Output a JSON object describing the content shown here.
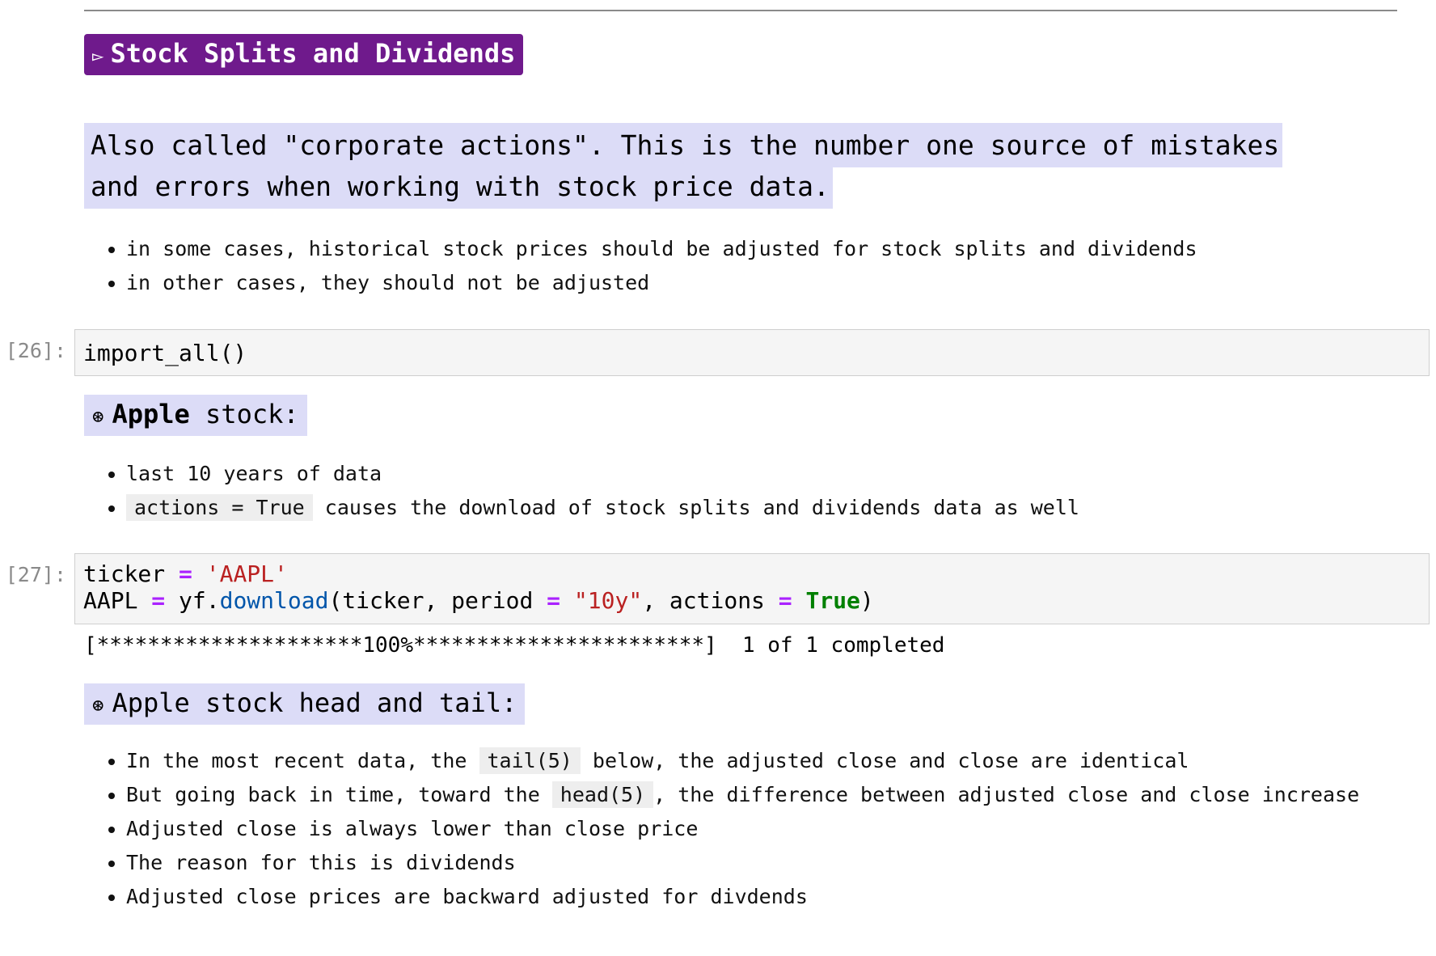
{
  "section": {
    "glyph": "▻",
    "title": "Stock Splits and Dividends"
  },
  "intro": {
    "text": "Also called \"corporate actions\". This is the number one source of mistakes and errors when working with stock price data."
  },
  "intro_bullets": [
    "in some cases, historical stock prices should be adjusted for stock splits and dividends",
    "in other cases, they should not be adjusted"
  ],
  "cell_26": {
    "prompt": "[26]:",
    "code": "import_all()"
  },
  "apple_header": {
    "glyph": "⊛",
    "bold": "Apple",
    "rest": " stock:"
  },
  "apple_bullets": {
    "item1": "last 10 years of data",
    "item2_code": "actions = True",
    "item2_text": " causes the download of stock splits and dividends data as well"
  },
  "cell_27": {
    "prompt": "[27]:",
    "line1": {
      "var": "ticker ",
      "op": "=",
      "sp": " ",
      "str": "'AAPL'"
    },
    "line2": {
      "var": "AAPL ",
      "op1": "=",
      "obj": " yf.",
      "fn": "download",
      "args1": "(ticker, period ",
      "op2": "=",
      "sp2": " ",
      "str": "\"10y\"",
      "args2": ", actions ",
      "op3": "=",
      "sp3": " ",
      "kw": "True",
      "close": ")"
    },
    "output": "[*********************100%***********************]  1 of 1 completed"
  },
  "head_tail_header": {
    "glyph": "⊛",
    "text": "Apple stock head and tail:"
  },
  "head_tail_bullets": {
    "b1_pre": "In the most recent data, the ",
    "b1_code": "tail(5)",
    "b1_post": " below, the adjusted close and close are identical",
    "b2_pre": "But going back in time, toward the ",
    "b2_code": "head(5)",
    "b2_post": ", the difference between adjusted close and close increase",
    "b3": "Adjusted close is always lower than close price",
    "b4": "The reason for this is dividends",
    "b5": "Adjusted close prices are backward adjusted for divdends"
  }
}
